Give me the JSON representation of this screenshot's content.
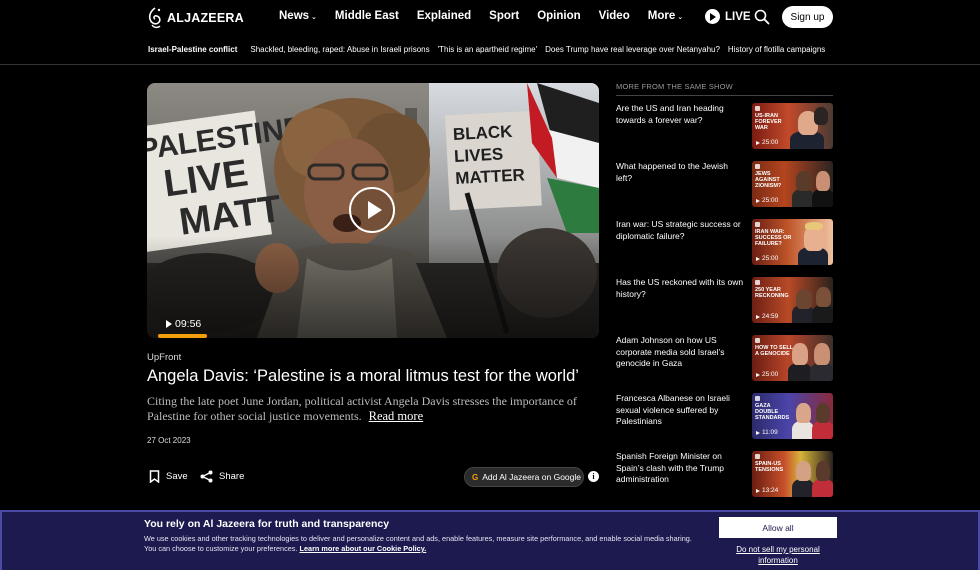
{
  "header": {
    "logo_text": "ALJAZEERA",
    "nav": [
      {
        "label": "News",
        "has_dropdown": true
      },
      {
        "label": "Middle East",
        "has_dropdown": false
      },
      {
        "label": "Explained",
        "has_dropdown": false
      },
      {
        "label": "Sport",
        "has_dropdown": false
      },
      {
        "label": "Opinion",
        "has_dropdown": false
      },
      {
        "label": "Video",
        "has_dropdown": false
      },
      {
        "label": "More",
        "has_dropdown": true
      }
    ],
    "live_label": "LIVE",
    "signup_label": "Sign up"
  },
  "trending": {
    "label": "Israel-Palestine conflict",
    "links": [
      "Shackled, bleeding, raped: Abuse in Israeli prisons",
      "'This is an apartheid regime'",
      "Does Trump have real leverage over Netanyahu?",
      "History of flotilla campaigns"
    ]
  },
  "video": {
    "duration": "09:56",
    "progress_fraction": 0.11,
    "sign_text_left": "PALESTINE LIVE MATT",
    "sign_text_right": "BLACK LIVES MATTER"
  },
  "article": {
    "program": "UpFront",
    "headline": "Angela Davis: ‘Palestine is a moral litmus test for the world’",
    "description": "Citing the late poet June Jordan, political activist Angela Davis stresses the importance of Palestine for other social justice movements.",
    "read_more": "Read more",
    "date": "27 Oct 2023",
    "save_label": "Save",
    "share_label": "Share",
    "google_label": "Add Al Jazeera on Google",
    "info_glyph": "i"
  },
  "sidebar": {
    "title": "MORE FROM THE SAME SHOW",
    "items": [
      {
        "title": "Are the US and Iran heading towards a forever war?",
        "thumb_label": "US-IRAN FOREVER WAR",
        "duration": "25:00"
      },
      {
        "title": "What happened to the Jewish left?",
        "thumb_label": "JEWS AGAINST ZIONISM?",
        "duration": "25:00"
      },
      {
        "title": "Iran war: US strategic success or diplomatic failure?",
        "thumb_label": "IRAN WAR: SUCCESS OR FAILURE?",
        "duration": "25:00"
      },
      {
        "title": "Has the US reckoned with its own history?",
        "thumb_label": "250 YEAR RECKONING",
        "duration": "24:59"
      },
      {
        "title": "Adam Johnson on how US corporate media sold Israel’s genocide in Gaza",
        "thumb_label": "HOW TO SELL A GENOCIDE",
        "duration": "25:00"
      },
      {
        "title": "Francesca Albanese on Israeli sexual violence suffered by Palestinians",
        "thumb_label": "GAZA DOUBLE STANDARDS",
        "duration": "11:09"
      },
      {
        "title": "Spanish Foreign Minister on Spain’s clash with the Trump administration",
        "thumb_label": "SPAIN-US TENSIONS",
        "duration": "13:24"
      }
    ]
  },
  "cookie": {
    "title": "You rely on Al Jazeera for truth and transparency",
    "text": "We use cookies and other tracking technologies to deliver and personalize content and ads, enable features, measure site performance, and enable social media sharing. You can choose to customize your preferences.",
    "link": "Learn more about our Cookie Policy.",
    "allow_label": "Allow all",
    "dns_label": "Do not sell my personal information"
  },
  "colors": {
    "background": "#000000",
    "accent": "#f59e0b",
    "cookie_bg": "#1c1a4f"
  }
}
